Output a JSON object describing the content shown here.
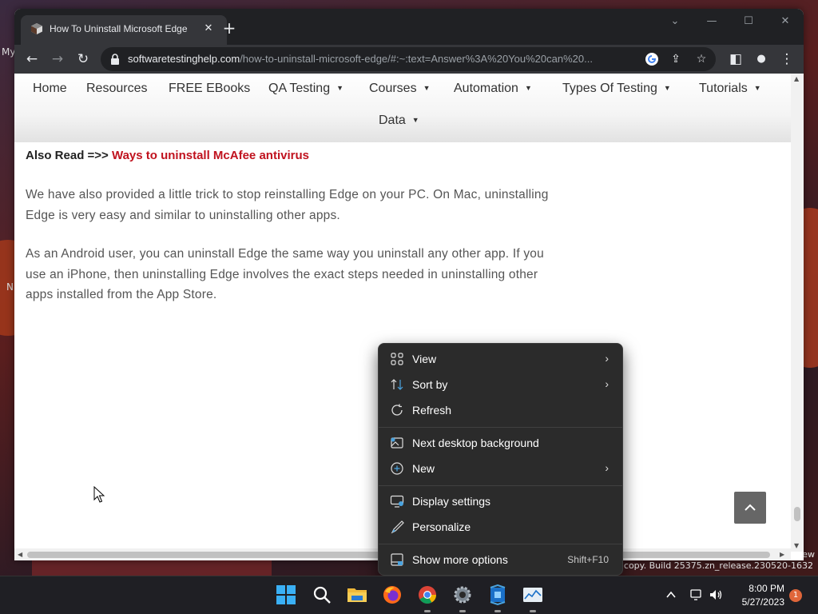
{
  "desktop": {
    "left_label_1": "My",
    "left_label_2": "N",
    "watermark_top": "ew",
    "watermark": "tion copy. Build 25375.zn_release.230520-1632"
  },
  "browser": {
    "tab": {
      "title": "How To Uninstall Microsoft Edge",
      "close": "✕"
    },
    "new_tab": "+",
    "window_controls": {
      "dropdown": "⌄",
      "minimize": "—",
      "maximize": "☐",
      "close": "✕"
    },
    "toolbar": {
      "back": "←",
      "forward": "→",
      "reload": "↻",
      "url_host": "softwaretestinghelp.com",
      "url_path": "/how-to-uninstall-microsoft-edge/#:~:text=Answer%3A%20You%20can%20...",
      "share": "⇪",
      "bookmark": "☆",
      "sidepanel": "◧",
      "profile": "●",
      "menu": "⋮"
    }
  },
  "nav": {
    "items": [
      {
        "label": "Home",
        "dropdown": false
      },
      {
        "label": "Resources",
        "dropdown": false
      },
      {
        "label": "FREE EBooks",
        "dropdown": false
      },
      {
        "label": "QA Testing",
        "dropdown": true
      },
      {
        "label": "Courses",
        "dropdown": true
      },
      {
        "label": "Automation",
        "dropdown": true
      },
      {
        "label": "Types Of Testing",
        "dropdown": true
      },
      {
        "label": "Tutorials",
        "dropdown": true
      },
      {
        "label": "Data",
        "dropdown": true
      }
    ],
    "caret": "▼"
  },
  "article": {
    "also_read_prefix": "Also Read =>> ",
    "also_read_link": "Ways to uninstall McAfee antivirus",
    "para1": "We have also provided a little trick to stop reinstalling Edge on your PC. On Mac, uninstalling Edge is very easy and similar to uninstalling other apps.",
    "para2": "As an Android user, you can uninstall Edge the same way you uninstall any other app. If you use an iPhone, then uninstalling Edge involves the exact steps needed in uninstalling other apps installed from the App Store."
  },
  "back_to_top": "^",
  "context_menu": {
    "items": [
      {
        "label": "View",
        "icon": "grid-icon",
        "submenu": true
      },
      {
        "label": "Sort by",
        "icon": "sort-icon",
        "submenu": true
      },
      {
        "label": "Refresh",
        "icon": "refresh-icon",
        "submenu": false
      },
      {
        "label": "Next desktop background",
        "icon": "image-icon",
        "submenu": false
      },
      {
        "label": "New",
        "icon": "plus-circle-icon",
        "submenu": true
      },
      {
        "label": "Display settings",
        "icon": "display-icon",
        "submenu": false
      },
      {
        "label": "Personalize",
        "icon": "brush-icon",
        "submenu": false
      },
      {
        "label": "Show more options",
        "icon": "more-options-icon",
        "shortcut": "Shift+F10"
      }
    ],
    "submenu_arrow": "›"
  },
  "taskbar": {
    "apps": [
      "windows-start",
      "search",
      "file-explorer",
      "firefox",
      "chrome",
      "settings",
      "app-blue",
      "task-manager"
    ],
    "time": "8:00 PM",
    "date": "5/27/2023",
    "notifications": "1"
  },
  "colors": {
    "accent_link": "#c0121e",
    "menu_bg": "#2b2b2b",
    "chrome_dark": "#202124"
  }
}
